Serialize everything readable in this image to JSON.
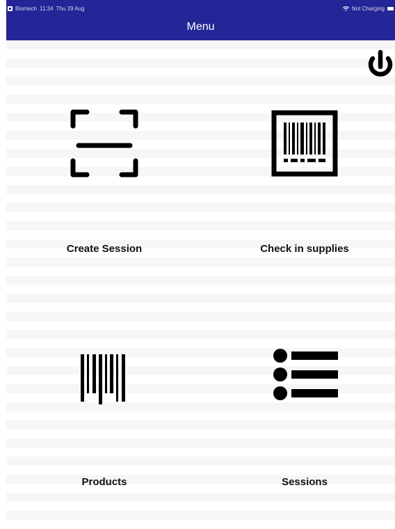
{
  "status_bar": {
    "app_name": "Biomech",
    "time": "11:34",
    "date": "Thu 29 Aug",
    "charging": "Not Charging"
  },
  "header": {
    "title": "Menu",
    "background_color": "#242596",
    "title_color": "#ffffff"
  },
  "actions": {
    "power_icon": "power-icon"
  },
  "tiles": [
    {
      "label": "Create Session",
      "icon": "scan-frame-icon"
    },
    {
      "label": "Check in supplies",
      "icon": "framed-barcode-icon"
    },
    {
      "label": "Products",
      "icon": "barcode-icon"
    },
    {
      "label": "Sessions",
      "icon": "list-icon"
    }
  ]
}
